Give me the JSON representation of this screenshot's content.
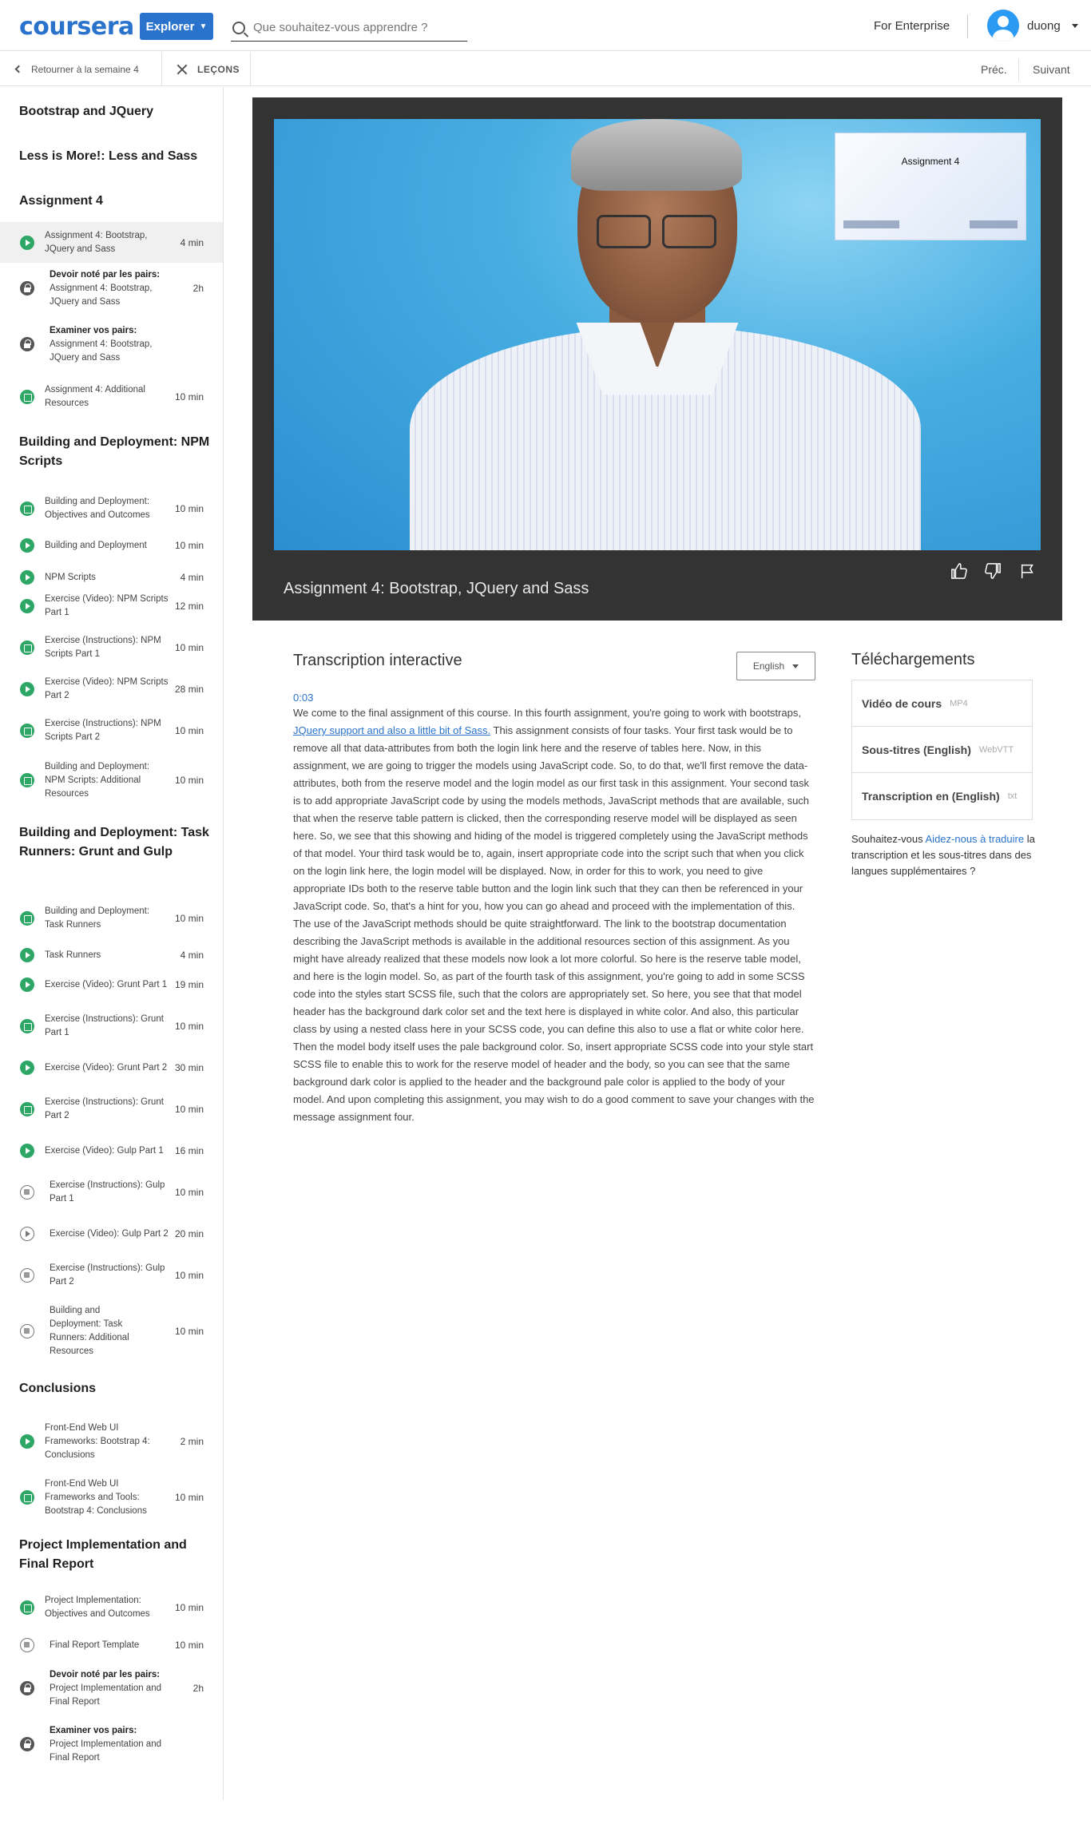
{
  "header": {
    "logo": "coursera",
    "explore": "Explorer",
    "search_placeholder": "Que souhaitez-vous apprendre ?",
    "enterprise": "For Enterprise",
    "user": "duong"
  },
  "subnav": {
    "back": "Retourner à la semaine 4",
    "lessons": "LEÇONS",
    "prev": "Préc.",
    "next": "Suivant"
  },
  "sidebar": {
    "sections": [
      "Bootstrap and JQuery",
      "Less is More!: Less and Sass",
      "Assignment 4",
      "Building and Deployment: NPM Scripts",
      "Building and Deployment: Task Runners: Grunt and Gulp",
      "Conclusions",
      "Project Implementation and Final Report"
    ],
    "items": [
      {
        "type": "video",
        "title": "Assignment 4: Bootstrap, JQuery and Sass",
        "duration": "4 min"
      },
      {
        "type": "locked",
        "prefix": "Devoir noté par les pairs:",
        "title": "Assignment 4: Bootstrap, JQuery and Sass",
        "duration": "2h"
      },
      {
        "type": "locked",
        "prefix": "Examiner vos pairs:",
        "title": "Assignment 4: Bootstrap, JQuery and Sass",
        "duration": ""
      },
      {
        "type": "reading",
        "title": "Assignment 4: Additional Resources",
        "duration": "10 min"
      },
      {
        "type": "reading",
        "title": "Building and Deployment: Objectives and Outcomes",
        "duration": "10 min"
      },
      {
        "type": "video",
        "title": "Building and Deployment",
        "duration": "10 min"
      },
      {
        "type": "video",
        "title": "NPM Scripts",
        "duration": "4 min"
      },
      {
        "type": "video",
        "title": "Exercise (Video): NPM Scripts Part 1",
        "duration": "12 min"
      },
      {
        "type": "reading",
        "title": "Exercise (Instructions): NPM Scripts Part 1",
        "duration": "10 min"
      },
      {
        "type": "video",
        "title": "Exercise (Video): NPM Scripts Part 2",
        "duration": "28 min"
      },
      {
        "type": "reading",
        "title": "Exercise (Instructions): NPM Scripts Part 2",
        "duration": "10 min"
      },
      {
        "type": "reading",
        "title": "Building and Deployment: NPM Scripts: Additional Resources",
        "duration": "10 min"
      },
      {
        "type": "reading",
        "title": "Building and Deployment: Task Runners",
        "duration": "10 min"
      },
      {
        "type": "video",
        "title": "Task Runners",
        "duration": "4 min"
      },
      {
        "type": "video",
        "title": "Exercise (Video): Grunt Part 1",
        "duration": "19 min"
      },
      {
        "type": "reading",
        "title": "Exercise (Instructions): Grunt Part 1",
        "duration": "10 min"
      },
      {
        "type": "video",
        "title": "Exercise (Video): Grunt Part 2",
        "duration": "30 min"
      },
      {
        "type": "reading",
        "title": "Exercise (Instructions): Grunt Part 2",
        "duration": "10 min"
      },
      {
        "type": "video",
        "title": "Exercise (Video): Gulp Part 1",
        "duration": "16 min"
      },
      {
        "type": "reading-todo",
        "title": "Exercise (Instructions): Gulp Part 1",
        "duration": "10 min"
      },
      {
        "type": "video-todo",
        "title": "Exercise (Video): Gulp Part 2",
        "duration": "20 min"
      },
      {
        "type": "reading-todo",
        "title": "Exercise (Instructions): Gulp Part 2",
        "duration": "10 min"
      },
      {
        "type": "reading-todo",
        "title": "Building and Deployment: Task Runners: Additional Resources",
        "duration": "10 min"
      },
      {
        "type": "video",
        "title": "Front-End Web UI Frameworks: Bootstrap 4: Conclusions",
        "duration": "2 min"
      },
      {
        "type": "reading",
        "title": "Front-End Web UI Frameworks and Tools: Bootstrap 4: Conclusions",
        "duration": "10 min"
      },
      {
        "type": "reading",
        "title": "Project Implementation: Objectives and Outcomes",
        "duration": "10 min"
      },
      {
        "type": "reading-todo",
        "title": "Final Report Template",
        "duration": "10 min"
      },
      {
        "type": "locked",
        "prefix": "Devoir noté par les pairs:",
        "title": "Project Implementation and Final Report",
        "duration": "2h"
      },
      {
        "type": "locked",
        "prefix": "Examiner vos pairs:",
        "title": "Project Implementation and Final Report",
        "duration": ""
      }
    ]
  },
  "video": {
    "title": "Assignment 4: Bootstrap, JQuery and Sass",
    "slide_title": "Assignment 4"
  },
  "transcript": {
    "heading": "Transcription interactive",
    "language": "English",
    "timecode": "0:03",
    "text_before": "We come to the final assignment of this course. In this fourth assignment, you're going to work with bootstraps,",
    "link": "JQuery support and also a little bit of Sass.",
    "text_after": " This assignment consists of four tasks. Your first task would be to remove all that data-attributes from both the login link here and the reserve of tables here. Now, in this assignment, we are going to trigger the models using JavaScript code. So, to do that, we'll first remove the data-attributes, both from the reserve model and the login model as our first task in this assignment. Your second task is to add appropriate JavaScript code by using the models methods, JavaScript methods that are available, such that when the reserve table pattern is clicked, then the corresponding reserve model will be displayed as seen here. So, we see that this showing and hiding of the model is triggered completely using the JavaScript methods of that model. Your third task would be to, again, insert appropriate code into the script such that when you click on the login link here, the login model will be displayed. Now, in order for this to work, you need to give appropriate IDs both to the reserve table button and the login link such that they can then be referenced in your JavaScript code. So, that's a hint for you, how you can go ahead and proceed with the implementation of this. The use of the JavaScript methods should be quite straightforward. The link to the bootstrap documentation describing the JavaScript methods is available in the additional resources section of this assignment. As you might have already realized that these models now look a lot more colorful. So here is the reserve table model, and here is the login model. So, as part of the fourth task of this assignment, you're going to add in some SCSS code into the styles start SCSS file, such that the colors are appropriately set. So here, you see that that model header has the background dark color set and the text here is displayed in white color. And also, this particular class by using a nested class here in your SCSS code, you can define this also to use a flat or white color here. Then the model body itself uses the pale background color. So, insert appropriate SCSS code into your style start SCSS file to enable this to work for the reserve model of header and the body, so you can see that the same background dark color is applied to the header and the background pale color is applied to the body of your model. And upon completing this assignment, you may wish to do a good comment to save your changes with the message assignment four."
  },
  "downloads": {
    "heading": "Téléchargements",
    "rows": [
      {
        "label": "Vidéo de cours",
        "ext": "MP4"
      },
      {
        "label": "Sous-titres (English)",
        "ext": "WebVTT"
      },
      {
        "label": "Transcription en (English)",
        "ext": "txt"
      }
    ],
    "help_before": "Souhaitez-vous ",
    "help_link": "Aidez-nous à traduire",
    "help_after": " la transcription et les sous-titres dans des langues supplémentaires ?"
  }
}
